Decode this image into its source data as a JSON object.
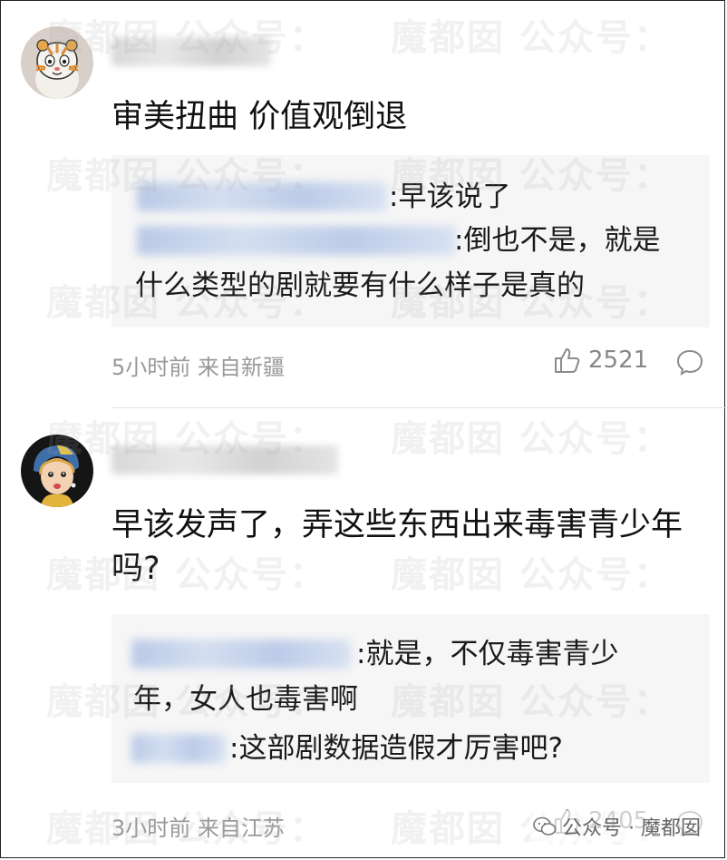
{
  "watermark": {
    "text": "魔都囡 公众号："
  },
  "comments": [
    {
      "text": "审美扭曲 价值观倒退",
      "replies": [
        {
          "text": ":早该说了"
        },
        {
          "text": ":倒也不是，就是"
        },
        {
          "text": "什么类型的剧就要有什么样子是真的"
        }
      ],
      "meta": "5小时前 来自新疆",
      "likes": "2521"
    },
    {
      "text": "早该发声了，弄这些东西出来毒害青少年吗?",
      "replies": [
        {
          "text": ":就是，不仅毒害青少"
        },
        {
          "text": "年，女人也毒害啊"
        },
        {
          "text": ":这部剧数据造假才厉害吧?"
        }
      ],
      "meta": "3小时前 来自江苏",
      "likes": "2405"
    }
  ],
  "brand": {
    "label": "公众号 · 魔都囡"
  },
  "colors": {
    "meta_gray": "#999999",
    "reply_bg": "#f6f6f6",
    "text": "#111111"
  }
}
